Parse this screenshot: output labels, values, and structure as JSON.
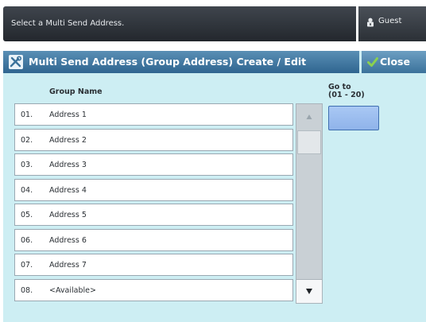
{
  "message_bar": {
    "text": "Select a Multi Send Address."
  },
  "user": {
    "label": "Guest",
    "icon": "user-lock-icon"
  },
  "title_bar": {
    "title": "Multi Send Address (Group Address) Create / Edit",
    "icon": "tools-icon",
    "close_label": "Close",
    "close_icon": "checkmark-icon"
  },
  "list": {
    "column_header": "Group Name",
    "rows": [
      {
        "num": "01.",
        "name": "Address 1"
      },
      {
        "num": "02.",
        "name": "Address 2"
      },
      {
        "num": "03.",
        "name": "Address 3"
      },
      {
        "num": "04.",
        "name": "Address 4"
      },
      {
        "num": "05.",
        "name": "Address 5"
      },
      {
        "num": "06.",
        "name": "Address 6"
      },
      {
        "num": "07.",
        "name": "Address 7"
      },
      {
        "num": "08.",
        "name": "<Available>"
      }
    ]
  },
  "goto": {
    "label": "Go to",
    "range": "(01 - 20)"
  },
  "colors": {
    "panel_bg": "#cdeef3",
    "title_bar": "#3b729b",
    "goto_button": "#9bbcf0",
    "close_check": "#8bd14f"
  }
}
